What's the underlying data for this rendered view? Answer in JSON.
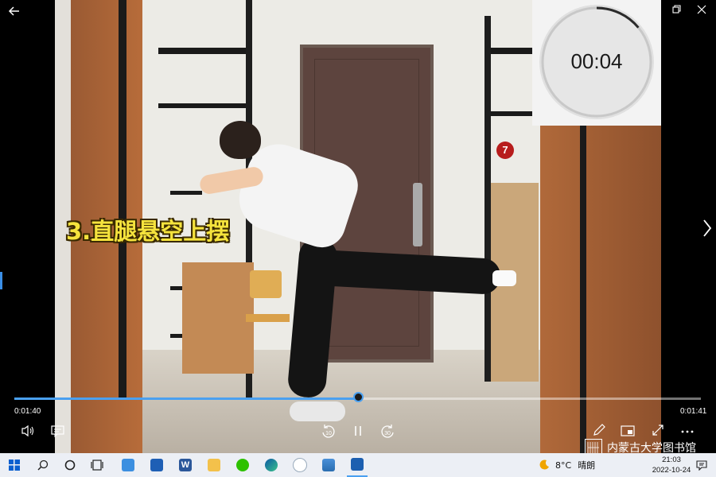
{
  "video": {
    "caption": "3.直腿悬空上摆",
    "room_number_badge": "7"
  },
  "timer": {
    "display": "00:04",
    "ring_progress": 0.14
  },
  "playback": {
    "current_time": "0:01:40",
    "total_time": "0:01:41",
    "progress": 0.5,
    "rewind_seconds": "10",
    "forward_seconds": "30"
  },
  "watermark": {
    "text": "内蒙古大学图书馆"
  },
  "icons": {
    "back": "back-arrow-icon",
    "minimize": "minimize-icon",
    "restore": "restore-icon",
    "close": "close-icon",
    "next": "chevron-right-icon",
    "volume": "volume-icon",
    "subtitles": "subtitles-icon",
    "rewind": "rewind-icon",
    "pause": "pause-icon",
    "forward": "forward-icon",
    "edit": "pen-icon",
    "miniplayer": "miniplayer-icon",
    "fullscreen": "fullscreen-icon",
    "more": "more-icon"
  },
  "taskbar": {
    "apps": [
      "start-icon",
      "search-icon",
      "cortana-icon",
      "task-view-icon",
      "file-explorer-icon",
      "store-icon",
      "word-icon",
      "folder-icon",
      "wechat-icon",
      "edge-icon",
      "photos-icon",
      "image-viewer-icon",
      "media-player-icon"
    ],
    "temperature": "8°C",
    "weather": "晴朗",
    "time": "21:03",
    "date": "2022-10-24"
  },
  "colors": {
    "accent": "#4aa0f0",
    "caption": "#f5e33d"
  }
}
